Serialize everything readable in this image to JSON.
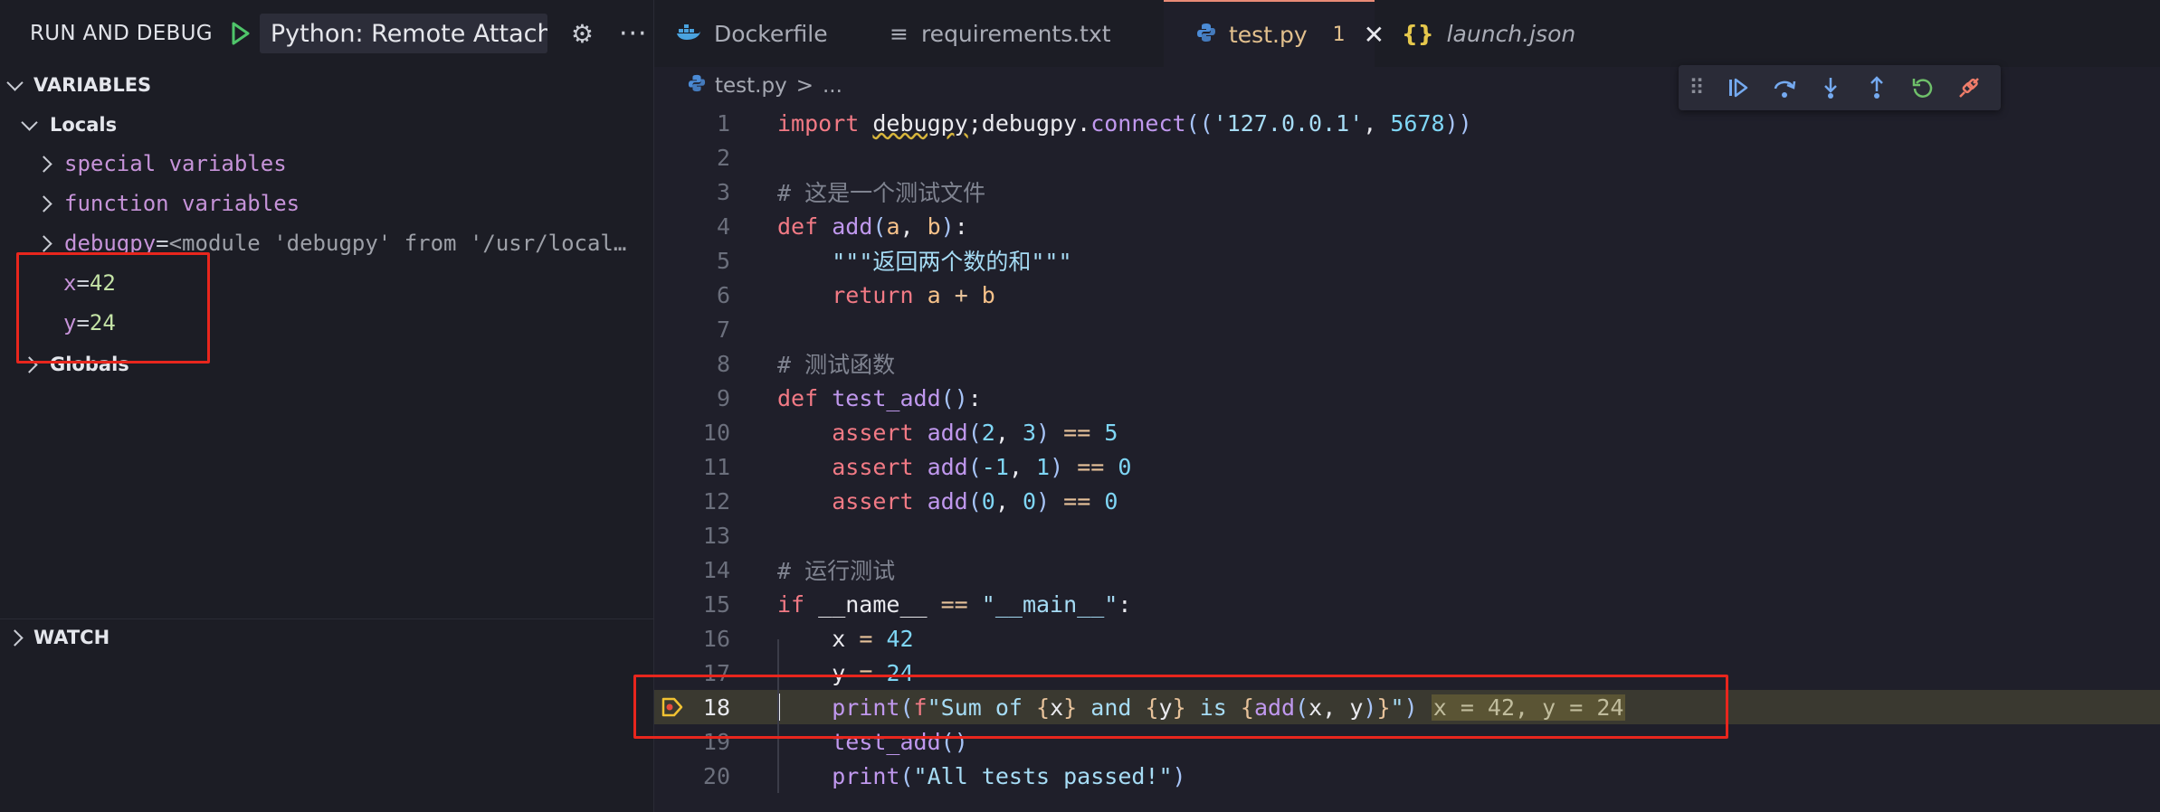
{
  "sidebar": {
    "title": "RUN AND DEBUG",
    "config_label": "Python: Remote Attach (",
    "variables_title": "VARIABLES",
    "locals_label": "Locals",
    "items": [
      {
        "name": "special variables"
      },
      {
        "name": "function variables"
      },
      {
        "name": "debugpy",
        "eq": " = ",
        "value": "<module 'debugpy' from '/usr/local…"
      },
      {
        "name": "x",
        "eq": " = ",
        "value": "42"
      },
      {
        "name": "y",
        "eq": " = ",
        "value": "24"
      }
    ],
    "globals_label": "Globals",
    "watch_title": "WATCH"
  },
  "tabs": [
    {
      "label": "Dockerfile",
      "icon": "docker-icon"
    },
    {
      "label": "requirements.txt",
      "icon": "text-file-icon"
    },
    {
      "label": "test.py",
      "badge": "1",
      "icon": "python-icon",
      "active": true
    },
    {
      "label": "launch.json",
      "icon": "json-icon"
    }
  ],
  "breadcrumb": {
    "file": "test.py",
    "separator": ">",
    "rest": "..."
  },
  "debug_toolbar": [
    "drag-handle-icon",
    "continue-icon",
    "step-over-icon",
    "step-into-icon",
    "step-out-icon",
    "restart-icon",
    "disconnect-icon"
  ],
  "editor": {
    "current_line": 18,
    "lines": [
      {
        "n": "1",
        "tokens": [
          [
            "import ",
            "kw"
          ],
          [
            "debugpy",
            "id"
          ],
          [
            ";",
            "id"
          ],
          [
            "debugpy",
            "id"
          ],
          [
            ".",
            "id"
          ],
          [
            "connect",
            "fn"
          ],
          [
            "(",
            "par"
          ],
          [
            "(",
            "par"
          ],
          [
            "'127.0.0.1'",
            "str"
          ],
          [
            ", ",
            "id"
          ],
          [
            "5678",
            "num"
          ],
          [
            ")",
            "par"
          ],
          [
            ")",
            "par"
          ]
        ]
      },
      {
        "n": "2",
        "tokens": []
      },
      {
        "n": "3",
        "tokens": [
          [
            "# 这是一个测试文件",
            "cm"
          ]
        ]
      },
      {
        "n": "4",
        "tokens": [
          [
            "def ",
            "kw"
          ],
          [
            "add",
            "fn"
          ],
          [
            "(",
            "par"
          ],
          [
            "a",
            "var"
          ],
          [
            ", ",
            "id"
          ],
          [
            "b",
            "var"
          ],
          [
            ")",
            "par"
          ],
          [
            ":",
            "id"
          ]
        ]
      },
      {
        "n": "5",
        "tokens": [
          [
            "    ",
            "id"
          ],
          [
            "\"\"\"返回两个数的和\"\"\"",
            "str"
          ]
        ]
      },
      {
        "n": "6",
        "tokens": [
          [
            "    ",
            "id"
          ],
          [
            "return ",
            "kw"
          ],
          [
            "a",
            "var"
          ],
          [
            " + ",
            "op"
          ],
          [
            "b",
            "var"
          ]
        ]
      },
      {
        "n": "7",
        "tokens": []
      },
      {
        "n": "8",
        "tokens": [
          [
            "# 测试函数",
            "cm"
          ]
        ]
      },
      {
        "n": "9",
        "tokens": [
          [
            "def ",
            "kw"
          ],
          [
            "test_add",
            "fn"
          ],
          [
            "(",
            "par"
          ],
          [
            ")",
            "par"
          ],
          [
            ":",
            "id"
          ]
        ]
      },
      {
        "n": "10",
        "tokens": [
          [
            "    ",
            "id"
          ],
          [
            "assert ",
            "kw"
          ],
          [
            "add",
            "fn"
          ],
          [
            "(",
            "par"
          ],
          [
            "2",
            "num"
          ],
          [
            ", ",
            "id"
          ],
          [
            "3",
            "num"
          ],
          [
            ")",
            "par"
          ],
          [
            " == ",
            "op"
          ],
          [
            "5",
            "num"
          ]
        ]
      },
      {
        "n": "11",
        "tokens": [
          [
            "    ",
            "id"
          ],
          [
            "assert ",
            "kw"
          ],
          [
            "add",
            "fn"
          ],
          [
            "(",
            "par"
          ],
          [
            "-1",
            "num"
          ],
          [
            ", ",
            "id"
          ],
          [
            "1",
            "num"
          ],
          [
            ")",
            "par"
          ],
          [
            " == ",
            "op"
          ],
          [
            "0",
            "num"
          ]
        ]
      },
      {
        "n": "12",
        "tokens": [
          [
            "    ",
            "id"
          ],
          [
            "assert ",
            "kw"
          ],
          [
            "add",
            "fn"
          ],
          [
            "(",
            "par"
          ],
          [
            "0",
            "num"
          ],
          [
            ", ",
            "id"
          ],
          [
            "0",
            "num"
          ],
          [
            ")",
            "par"
          ],
          [
            " == ",
            "op"
          ],
          [
            "0",
            "num"
          ]
        ]
      },
      {
        "n": "13",
        "tokens": []
      },
      {
        "n": "14",
        "tokens": [
          [
            "# 运行测试",
            "cm"
          ]
        ]
      },
      {
        "n": "15",
        "tokens": [
          [
            "if ",
            "kw"
          ],
          [
            "__name__",
            "id"
          ],
          [
            " == ",
            "op"
          ],
          [
            "\"__main__\"",
            "str"
          ],
          [
            ":",
            "id"
          ]
        ]
      },
      {
        "n": "16",
        "tokens": [
          [
            "    ",
            "id"
          ],
          [
            "x",
            "id"
          ],
          [
            " = ",
            "op"
          ],
          [
            "42",
            "num"
          ]
        ]
      },
      {
        "n": "17",
        "tokens": [
          [
            "    ",
            "id"
          ],
          [
            "y",
            "id"
          ],
          [
            " = ",
            "op"
          ],
          [
            "24",
            "num"
          ]
        ]
      },
      {
        "n": "18",
        "tokens": [
          [
            "    ",
            "id"
          ],
          [
            "print",
            "fn"
          ],
          [
            "(",
            "par"
          ],
          [
            "f",
            "kw"
          ],
          [
            "\"Sum of ",
            "str"
          ],
          [
            "{",
            "op"
          ],
          [
            "x",
            "id"
          ],
          [
            "}",
            "op"
          ],
          [
            " and ",
            "str"
          ],
          [
            "{",
            "op"
          ],
          [
            "y",
            "id"
          ],
          [
            "}",
            "op"
          ],
          [
            " is ",
            "str"
          ],
          [
            "{",
            "op"
          ],
          [
            "add",
            "fn"
          ],
          [
            "(",
            "par"
          ],
          [
            "x",
            "id"
          ],
          [
            ", ",
            "id"
          ],
          [
            "y",
            "id"
          ],
          [
            ")",
            "par"
          ],
          [
            "}",
            "op"
          ],
          [
            "\"",
            "str"
          ],
          [
            ")",
            "par"
          ],
          [
            " ",
            "id"
          ],
          [
            "x = 42, y = 24",
            "inline"
          ]
        ]
      },
      {
        "n": "19",
        "tokens": [
          [
            "    ",
            "id"
          ],
          [
            "test_add",
            "fn"
          ],
          [
            "(",
            "par"
          ],
          [
            ")",
            "par"
          ]
        ]
      },
      {
        "n": "20",
        "tokens": [
          [
            "    ",
            "id"
          ],
          [
            "print",
            "fn"
          ],
          [
            "(",
            "par"
          ],
          [
            "\"All tests passed!\"",
            "str"
          ],
          [
            ")",
            "par"
          ]
        ]
      }
    ]
  },
  "colors": {
    "accent_tab": "#e98b76",
    "highlight_box": "#e8261d",
    "current_line": "#3a3930"
  }
}
